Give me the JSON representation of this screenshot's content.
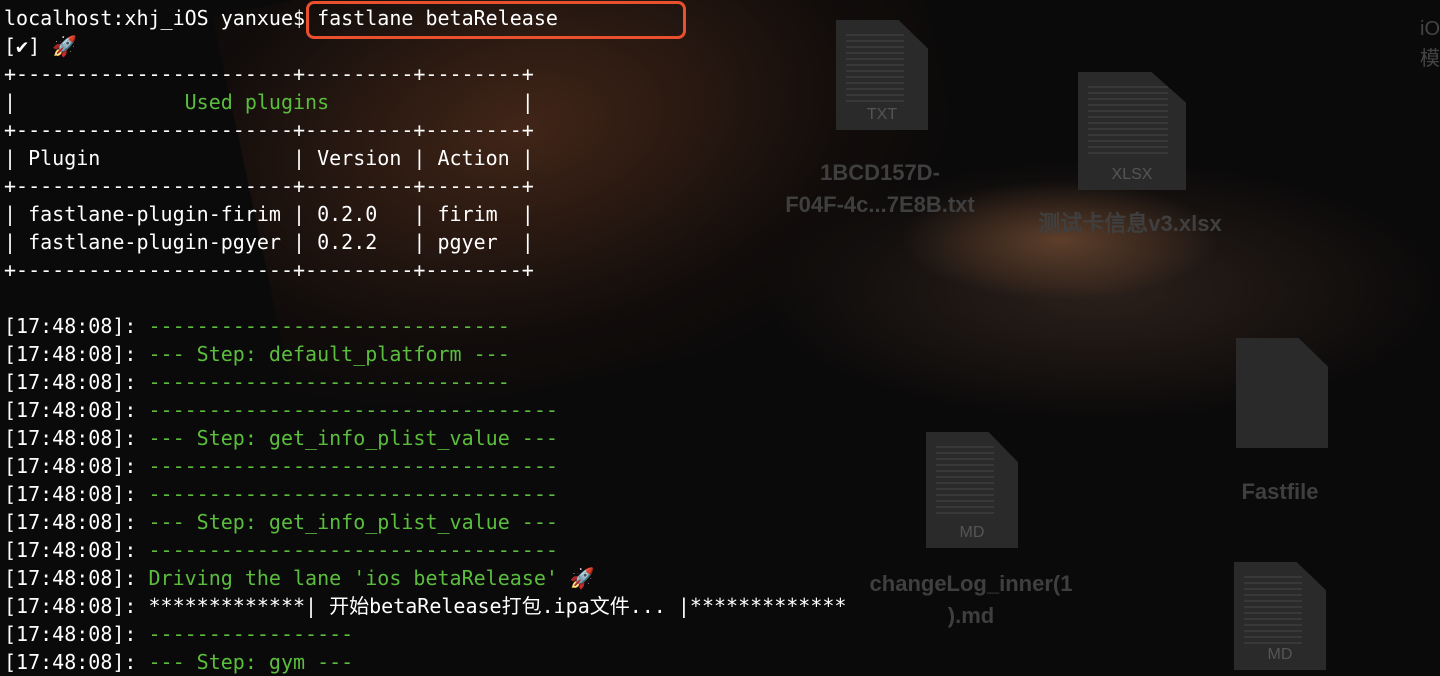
{
  "desktop": {
    "files": [
      {
        "ext": "TXT",
        "label": "1BCD157D-\nF04F-4c...7E8B.txt"
      },
      {
        "ext": "XLSX",
        "label": "测试卡信息v3.xlsx"
      },
      {
        "ext": "",
        "label": "Fastfile"
      },
      {
        "ext": "MD",
        "label": "changeLog_inner(1\n).md"
      },
      {
        "ext": "MD",
        "label": ""
      }
    ],
    "edge_text": "iO\n模"
  },
  "terminal": {
    "prompt": "localhost:xhj_iOS yanxue$ ",
    "command": "fastlane betaRelease",
    "check_line": "[✔] 🚀",
    "table": {
      "border": "+-----------------------+---------+--------+",
      "title_left": "|              ",
      "title": "Used plugins",
      "title_right": "                |",
      "header": "| Plugin                | Version | Action |",
      "rows": [
        "| fastlane-plugin-firim | 0.2.0   | firim  |",
        "| fastlane-plugin-pgyer | 0.2.2   | pgyer  |"
      ]
    },
    "log": [
      {
        "ts": "[17:48:08]: ",
        "msg": "------------------------------",
        "style": "green"
      },
      {
        "ts": "[17:48:08]: ",
        "msg": "--- Step: default_platform ---",
        "style": "green"
      },
      {
        "ts": "[17:48:08]: ",
        "msg": "------------------------------",
        "style": "green"
      },
      {
        "ts": "[17:48:08]: ",
        "msg": "----------------------------------",
        "style": "green"
      },
      {
        "ts": "[17:48:08]: ",
        "msg": "--- Step: get_info_plist_value ---",
        "style": "green"
      },
      {
        "ts": "[17:48:08]: ",
        "msg": "----------------------------------",
        "style": "green"
      },
      {
        "ts": "[17:48:08]: ",
        "msg": "----------------------------------",
        "style": "green"
      },
      {
        "ts": "[17:48:08]: ",
        "msg": "--- Step: get_info_plist_value ---",
        "style": "green"
      },
      {
        "ts": "[17:48:08]: ",
        "msg": "----------------------------------",
        "style": "green"
      },
      {
        "ts": "[17:48:08]: ",
        "msg": "Driving the lane 'ios betaRelease' 🚀",
        "style": "green"
      },
      {
        "ts": "[17:48:08]: ",
        "msg": "*************| 开始betaRelease打包.ipa文件... |*************",
        "style": "white"
      },
      {
        "ts": "[17:48:08]: ",
        "msg": "-----------------",
        "style": "green"
      },
      {
        "ts": "[17:48:08]: ",
        "msg": "--- Step: gym ---",
        "style": "green"
      }
    ]
  },
  "colors": {
    "highlight_box": "#e8502e",
    "green": "#5bbd3d"
  }
}
